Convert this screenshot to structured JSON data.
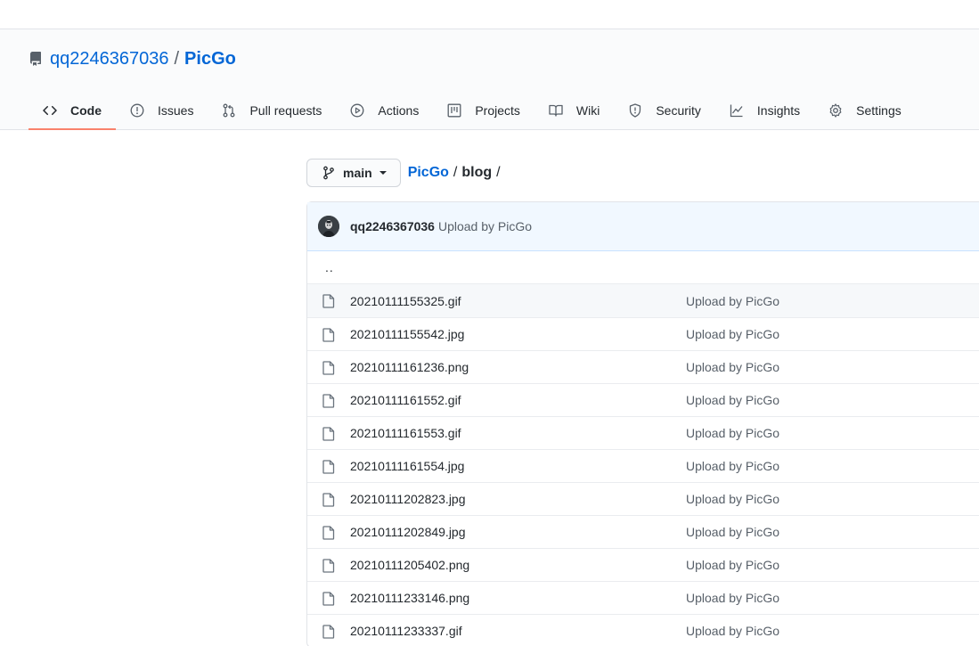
{
  "repo": {
    "owner": "qq2246367036",
    "separator": "/",
    "name": "PicGo"
  },
  "tabs": [
    {
      "label": "Code",
      "icon": "code-icon",
      "selected": true
    },
    {
      "label": "Issues",
      "icon": "issue-opened-icon"
    },
    {
      "label": "Pull requests",
      "icon": "git-pull-request-icon"
    },
    {
      "label": "Actions",
      "icon": "play-icon"
    },
    {
      "label": "Projects",
      "icon": "project-icon"
    },
    {
      "label": "Wiki",
      "icon": "book-icon"
    },
    {
      "label": "Security",
      "icon": "shield-icon"
    },
    {
      "label": "Insights",
      "icon": "graph-icon"
    },
    {
      "label": "Settings",
      "icon": "gear-icon"
    }
  ],
  "branch": {
    "label": "main"
  },
  "breadcrumb": {
    "root": "PicGo",
    "sep": "/",
    "current": "blog",
    "trailing_sep": "/"
  },
  "commit": {
    "author": "qq2246367036",
    "message": "Upload by PicGo"
  },
  "parent_dir": "..",
  "files": [
    {
      "name": "20210111155325.gif",
      "message": "Upload by PicGo"
    },
    {
      "name": "20210111155542.jpg",
      "message": "Upload by PicGo"
    },
    {
      "name": "20210111161236.png",
      "message": "Upload by PicGo"
    },
    {
      "name": "20210111161552.gif",
      "message": "Upload by PicGo"
    },
    {
      "name": "20210111161553.gif",
      "message": "Upload by PicGo"
    },
    {
      "name": "20210111161554.jpg",
      "message": "Upload by PicGo"
    },
    {
      "name": "20210111202823.jpg",
      "message": "Upload by PicGo"
    },
    {
      "name": "20210111202849.jpg",
      "message": "Upload by PicGo"
    },
    {
      "name": "20210111205402.png",
      "message": "Upload by PicGo"
    },
    {
      "name": "20210111233146.png",
      "message": "Upload by PicGo"
    },
    {
      "name": "20210111233337.gif",
      "message": "Upload by PicGo"
    }
  ],
  "colors": {
    "link": "#0366d6",
    "tab_underline": "#f9826c",
    "commit_bar_bg": "#f1f8ff"
  }
}
